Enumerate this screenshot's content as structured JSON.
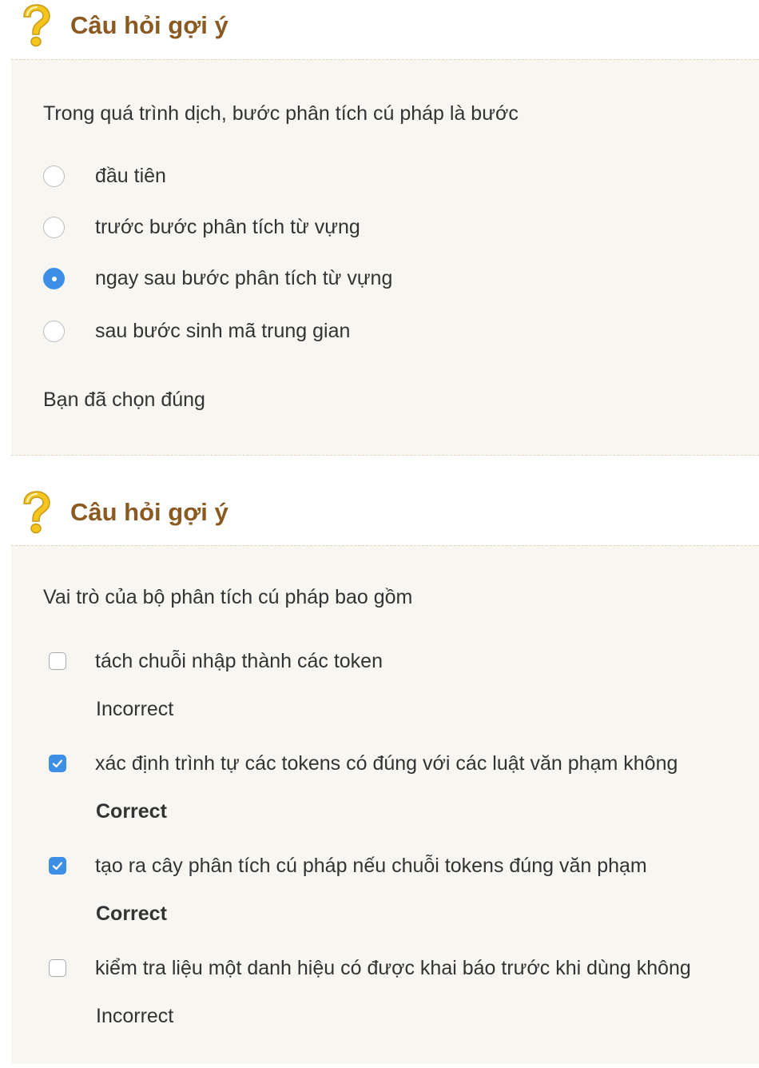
{
  "section1": {
    "title": "Câu hỏi gợi ý",
    "icon": "question-mark-icon",
    "question": "Trong quá trình dịch, bước phân tích cú pháp là bước",
    "options": [
      {
        "label": "đầu tiên",
        "selected": false
      },
      {
        "label": "trước bước phân tích từ vựng",
        "selected": false
      },
      {
        "label": "ngay sau bước phân tích từ vựng",
        "selected": true
      },
      {
        "label": "sau bước sinh mã trung gian",
        "selected": false
      }
    ],
    "result": "Bạn đã chọn đúng"
  },
  "section2": {
    "title": "Câu hỏi gợi ý",
    "icon": "question-mark-icon",
    "question": "Vai trò của bộ phân tích cú pháp bao gồm",
    "options": [
      {
        "label": "tách chuỗi nhập thành các token",
        "checked": false,
        "feedback": "Incorrect"
      },
      {
        "label": "xác định trình tự các tokens có đúng với các luật văn phạm không",
        "checked": true,
        "feedback": "Correct"
      },
      {
        "label": "tạo ra cây phân tích cú pháp nếu chuỗi tokens đúng văn phạm",
        "checked": true,
        "feedback": "Correct"
      },
      {
        "label": "kiểm tra liệu một danh hiệu có được khai báo trước khi dùng không",
        "checked": false,
        "feedback": "Incorrect"
      }
    ]
  },
  "colors": {
    "title": "#8a5a22",
    "panel_bg": "#f7f6f1",
    "accent": "#3d8fe6",
    "icon_yellow": "#f3c51d"
  }
}
